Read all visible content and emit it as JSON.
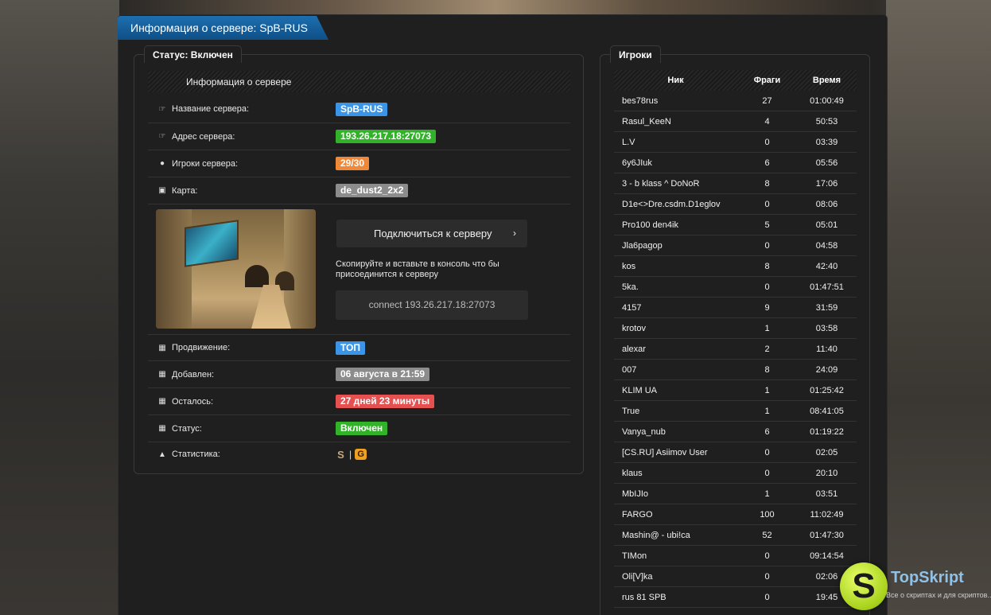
{
  "header": {
    "title": "Информация о сервере: SpB-RUS"
  },
  "left_panel": {
    "legend": "Статус: Включен",
    "section_title": "Информация о сервере",
    "rows": {
      "name": {
        "label": "Название сервера:",
        "value": "SpB-RUS",
        "color": "#3a95e8",
        "icon": "hand-pointer-icon"
      },
      "address": {
        "label": "Адрес сервера:",
        "value": "193.26.217.18:27073",
        "color": "#31b229",
        "icon": "hand-pointer-icon"
      },
      "players": {
        "label": "Игроки сервера:",
        "value": "29/30",
        "color": "#f0883a",
        "icon": "user-icon"
      },
      "map": {
        "label": "Карта:",
        "value": "de_dust2_2x2",
        "color": "#8c8c8c",
        "icon": "image-icon"
      },
      "promo": {
        "label": "Продвижение:",
        "value": "ТОП",
        "color": "#3a95e8",
        "icon": "calendar-icon"
      },
      "added": {
        "label": "Добавлен:",
        "value": "06 августа в 21:59",
        "color": "#8c8c8c",
        "icon": "calendar-icon"
      },
      "left": {
        "label": "Осталось:",
        "value": "27 дней 23 минуты",
        "color": "#e55050",
        "icon": "calendar-icon"
      },
      "status": {
        "label": "Статус:",
        "value": "Включен",
        "color": "#31b229",
        "icon": "calendar-icon"
      },
      "stats": {
        "label": "Статистика:",
        "icon": "chevron-up-icon"
      }
    },
    "connect_button": "Подключиться к серверу",
    "connect_arrow": "›",
    "copy_hint": "Скопируйте и вставьте в консоль что бы присоединится к серверу",
    "connect_command": "connect 193.26.217.18:27073",
    "stat_separator": "|"
  },
  "right_panel": {
    "legend": "Игроки",
    "columns": {
      "nick": "Ник",
      "frags": "Фраги",
      "time": "Время"
    },
    "players": [
      {
        "nick": "bes78rus",
        "frags": "27",
        "time": "01:00:49"
      },
      {
        "nick": "Rasul_KeeN",
        "frags": "4",
        "time": "50:53"
      },
      {
        "nick": "L.V",
        "frags": "0",
        "time": "03:39"
      },
      {
        "nick": "6y6JIuk",
        "frags": "6",
        "time": "05:56"
      },
      {
        "nick": "3 - b klass ^ DoNoR",
        "frags": "8",
        "time": "17:06"
      },
      {
        "nick": "D1e<>Dre.csdm.D1eglov",
        "frags": "0",
        "time": "08:06"
      },
      {
        "nick": "Pro100 den4ik",
        "frags": "5",
        "time": "05:01"
      },
      {
        "nick": "Jla6pagop",
        "frags": "0",
        "time": "04:58"
      },
      {
        "nick": "kos",
        "frags": "8",
        "time": "42:40"
      },
      {
        "nick": "5ka.",
        "frags": "0",
        "time": "01:47:51"
      },
      {
        "nick": "4157",
        "frags": "9",
        "time": "31:59"
      },
      {
        "nick": "krotov",
        "frags": "1",
        "time": "03:58"
      },
      {
        "nick": "alexar",
        "frags": "2",
        "time": "11:40"
      },
      {
        "nick": "007",
        "frags": "8",
        "time": "24:09"
      },
      {
        "nick": "KLIM UA",
        "frags": "1",
        "time": "01:25:42"
      },
      {
        "nick": "True",
        "frags": "1",
        "time": "08:41:05"
      },
      {
        "nick": "Vanya_nub",
        "frags": "6",
        "time": "01:19:22"
      },
      {
        "nick": "[CS.RU] Asiimov User",
        "frags": "0",
        "time": "02:05"
      },
      {
        "nick": "klaus",
        "frags": "0",
        "time": "20:10"
      },
      {
        "nick": "MbIJIo",
        "frags": "1",
        "time": "03:51"
      },
      {
        "nick": "FARGO",
        "frags": "100",
        "time": "11:02:49"
      },
      {
        "nick": "Mashin@ - ubi!ca",
        "frags": "52",
        "time": "01:47:30"
      },
      {
        "nick": "TIMon",
        "frags": "0",
        "time": "09:14:54"
      },
      {
        "nick": "Oli[V]ka",
        "frags": "0",
        "time": "02:06"
      },
      {
        "nick": "rus 81 SPB",
        "frags": "0",
        "time": "19:45"
      }
    ]
  },
  "watermark": {
    "letter": "S",
    "title": "TopSkript",
    "subtitle": "Все о скриптах и для скриптов..."
  }
}
